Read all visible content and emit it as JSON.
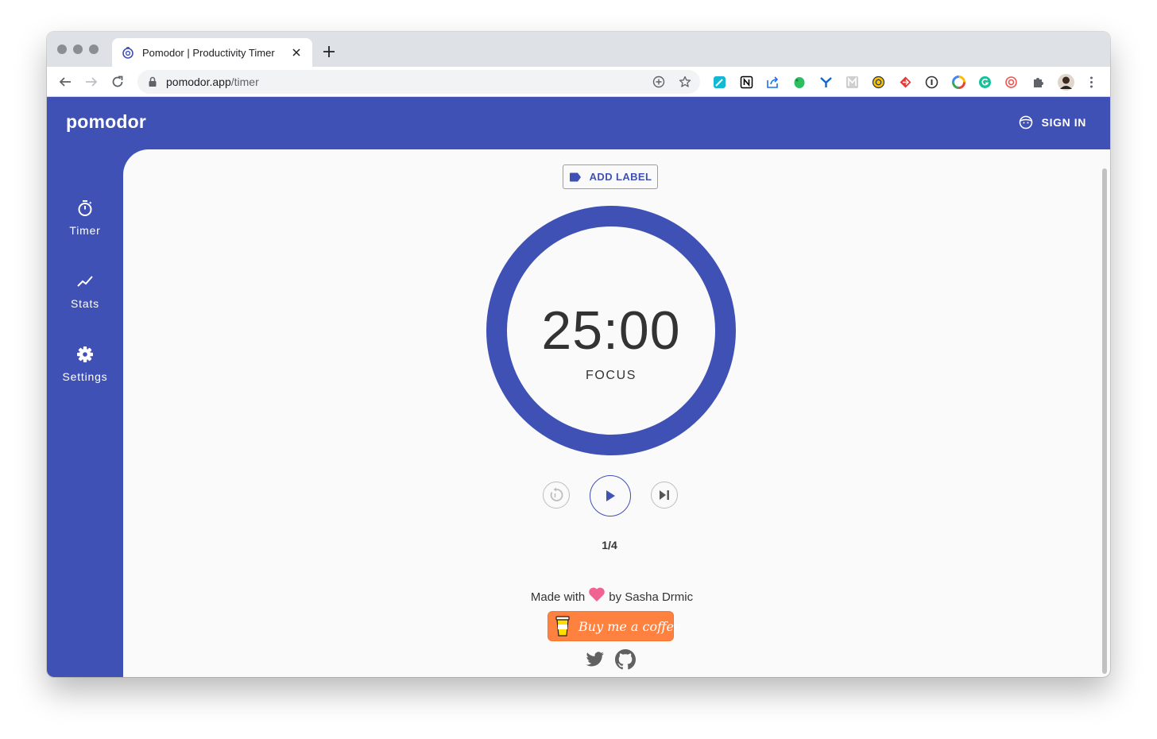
{
  "browser": {
    "tab_title": "Pomodor | Productivity Timer",
    "url_host": "pomodor.app",
    "url_path": "/timer"
  },
  "app": {
    "logo": "pomodor",
    "sign_in_label": "SIGN IN",
    "accent_color": "#3f51b5"
  },
  "sidebar": {
    "items": [
      {
        "label": "Timer",
        "icon": "stopwatch-icon"
      },
      {
        "label": "Stats",
        "icon": "trending-up-icon"
      },
      {
        "label": "Settings",
        "icon": "gear-icon"
      }
    ]
  },
  "timer": {
    "add_label": "ADD LABEL",
    "time": "25:00",
    "phase": "FOCUS",
    "round": "1/4"
  },
  "footer": {
    "made_with": "Made with",
    "by": "by Sasha Drmic",
    "coffee_label": "Buy me a coffee",
    "heart_color": "#f06292",
    "coffee_color": "#ff813f"
  }
}
